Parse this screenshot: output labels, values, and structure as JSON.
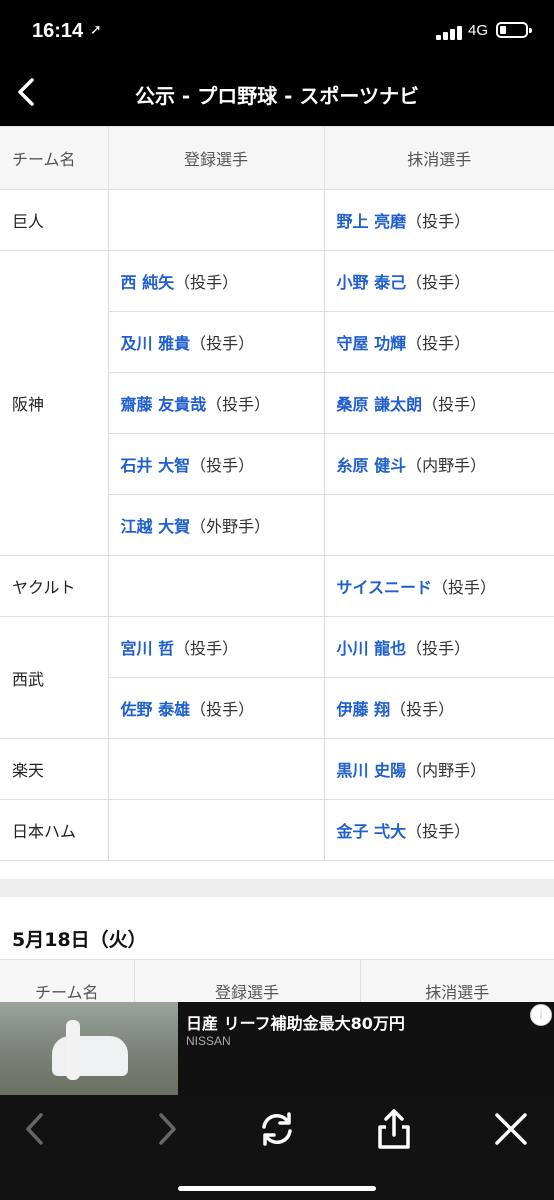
{
  "status": {
    "time": "16:14",
    "network": "4G"
  },
  "nav": {
    "title": "公示 - プロ野球 - スポーツナビ"
  },
  "table": {
    "headers": {
      "team": "チーム名",
      "registered": "登録選手",
      "deregistered": "抹消選手"
    },
    "rows": [
      {
        "team": "巨人",
        "reg_name": "",
        "reg_pos": "",
        "dereg_name": "野上 亮磨",
        "dereg_pos": "（投手）"
      },
      {
        "team": "阪神",
        "reg_name": "西 純矢",
        "reg_pos": "（投手）",
        "dereg_name": "小野 泰己",
        "dereg_pos": "（投手）"
      },
      {
        "team": "",
        "reg_name": "及川 雅貴",
        "reg_pos": "（投手）",
        "dereg_name": "守屋 功輝",
        "dereg_pos": "（投手）"
      },
      {
        "team": "",
        "reg_name": "齋藤 友貴哉",
        "reg_pos": "（投手）",
        "dereg_name": "桑原 謙太朗",
        "dereg_pos": "（投手）"
      },
      {
        "team": "",
        "reg_name": "石井 大智",
        "reg_pos": "（投手）",
        "dereg_name": "糸原 健斗",
        "dereg_pos": "（内野手）"
      },
      {
        "team": "",
        "reg_name": "江越 大賀",
        "reg_pos": "（外野手）",
        "dereg_name": "",
        "dereg_pos": ""
      },
      {
        "team": "ヤクルト",
        "reg_name": "",
        "reg_pos": "",
        "dereg_name": "サイスニード",
        "dereg_pos": "（投手）"
      },
      {
        "team": "西武",
        "reg_name": "宮川 哲",
        "reg_pos": "（投手）",
        "dereg_name": "小川 龍也",
        "dereg_pos": "（投手）"
      },
      {
        "team": "",
        "reg_name": "佐野 泰雄",
        "reg_pos": "（投手）",
        "dereg_name": "伊藤 翔",
        "dereg_pos": "（投手）"
      },
      {
        "team": "楽天",
        "reg_name": "",
        "reg_pos": "",
        "dereg_name": "黒川 史陽",
        "dereg_pos": "（内野手）"
      },
      {
        "team": "日本ハム",
        "reg_name": "",
        "reg_pos": "",
        "dereg_name": "金子 弌大",
        "dereg_pos": "（投手）"
      }
    ]
  },
  "next_section": {
    "date": "5月18日（火）",
    "headers": {
      "team": "チーム名",
      "registered": "登録選手",
      "deregistered": "抹消選手"
    }
  },
  "ad": {
    "headline": "日産 リーフ補助金最大80万円",
    "brand": "NISSAN",
    "info_icon": "i"
  },
  "toolbar": {
    "icons": [
      "back-icon",
      "forward-icon",
      "reload-icon",
      "share-icon",
      "close-icon"
    ]
  }
}
